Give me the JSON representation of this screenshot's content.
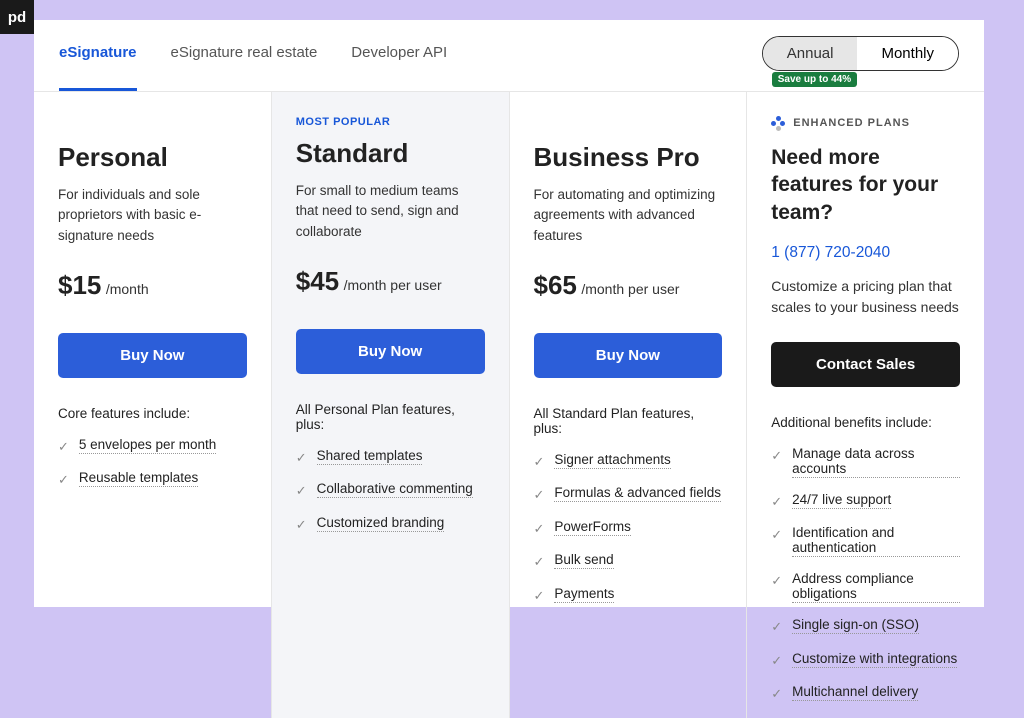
{
  "logo": "pd",
  "tabs": [
    {
      "label": "eSignature",
      "active": true
    },
    {
      "label": "eSignature real estate"
    },
    {
      "label": "Developer API"
    }
  ],
  "period": {
    "annual": "Annual",
    "monthly": "Monthly",
    "save": "Save up to 44%"
  },
  "plans": [
    {
      "title": "Personal",
      "desc": "For individuals and sole proprietors with basic e-signature needs",
      "price": "$15",
      "period": "/month",
      "button": "Buy Now",
      "features_intro": "Core features include:",
      "features": [
        "5 envelopes per month",
        "Reusable templates"
      ]
    },
    {
      "popular": "MOST POPULAR",
      "title": "Standard",
      "desc": "For small to medium teams that need to send, sign and collaborate",
      "price": "$45",
      "period": "/month per user",
      "button": "Buy Now",
      "features_intro": "All Personal Plan features, plus:",
      "features": [
        "Shared templates",
        "Collaborative commenting",
        "Customized branding"
      ]
    },
    {
      "title": "Business Pro",
      "desc": "For automating and optimizing agreements with advanced features",
      "price": "$65",
      "period": "/month per user",
      "button": "Buy Now",
      "features_intro": "All Standard Plan features, plus:",
      "features": [
        "Signer attachments",
        "Formulas & advanced fields",
        "PowerForms",
        "Bulk send",
        "Payments"
      ]
    }
  ],
  "enhanced": {
    "label": "ENHANCED PLANS",
    "title": "Need more features for your team?",
    "phone": "1 (877) 720-2040",
    "desc": "Customize a pricing plan that scales to your business needs",
    "button": "Contact Sales",
    "features_intro": "Additional benefits include:",
    "features": [
      "Manage data across accounts",
      "24/7 live support",
      "Identification and authentication",
      "Address compliance obligations",
      "Single sign-on (SSO)",
      "Customize with integrations",
      "Multichannel delivery"
    ]
  }
}
